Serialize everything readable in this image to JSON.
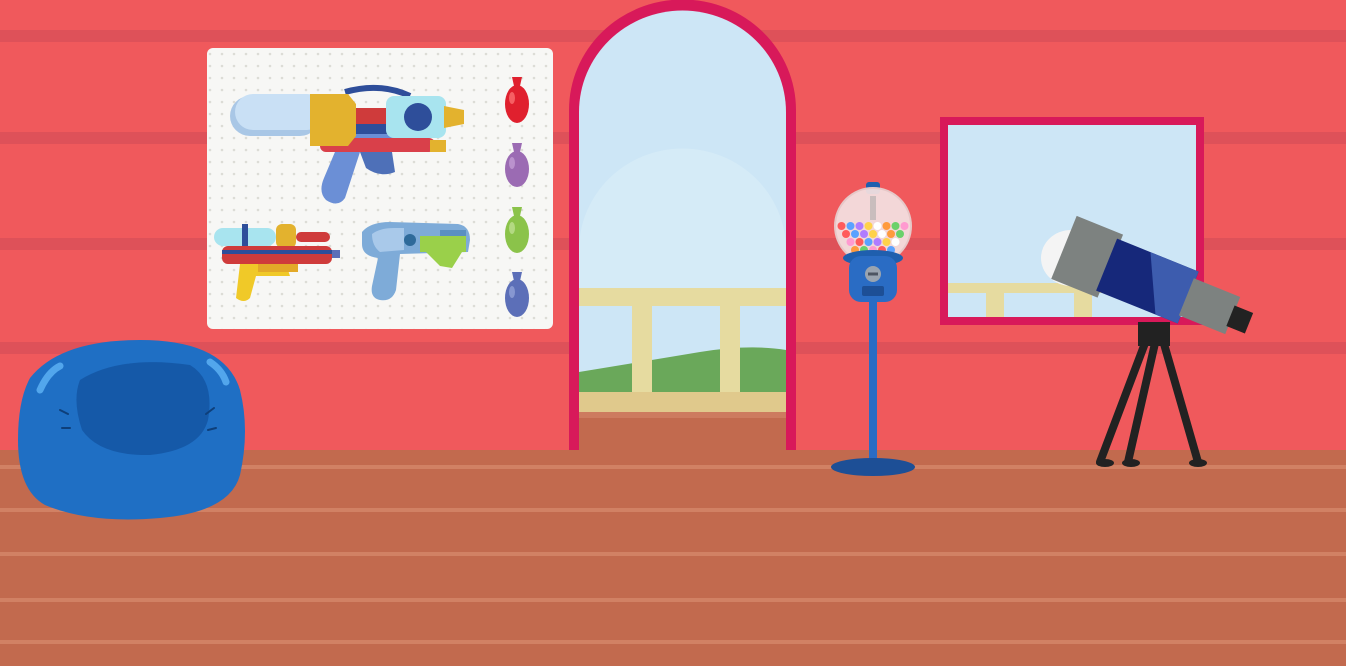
{
  "scene": {
    "name": "playroom",
    "colors": {
      "wall": "#f0595c",
      "wall_stripe": "#cf4a57",
      "floor": "#c26a4e",
      "floor_stripe": "#d4876a",
      "trim": "#d8195a",
      "sky": "#cde6f6",
      "railing": "#e6dba0",
      "hill": "#6aa85a",
      "beanbag": "#1f6fc4",
      "pegboard": "#f7f7f5"
    }
  },
  "pegboard": {
    "items": [
      {
        "name": "large-water-blaster"
      },
      {
        "name": "small-water-blaster"
      },
      {
        "name": "water-pistol"
      }
    ],
    "balloons": [
      {
        "name": "red-water-balloon",
        "color": "#e0202e"
      },
      {
        "name": "purple-water-balloon",
        "color": "#9b6bb3"
      },
      {
        "name": "green-water-balloon",
        "color": "#8bc34a"
      },
      {
        "name": "blue-water-balloon",
        "color": "#5c6fb8"
      }
    ]
  },
  "gumball_machine": {
    "gumball_colors": [
      "#ff5b5b",
      "#ffd24a",
      "#6ad16a",
      "#5aa2ff",
      "#ffffff",
      "#ff9ad0",
      "#b07cff",
      "#ff9a3d"
    ]
  }
}
